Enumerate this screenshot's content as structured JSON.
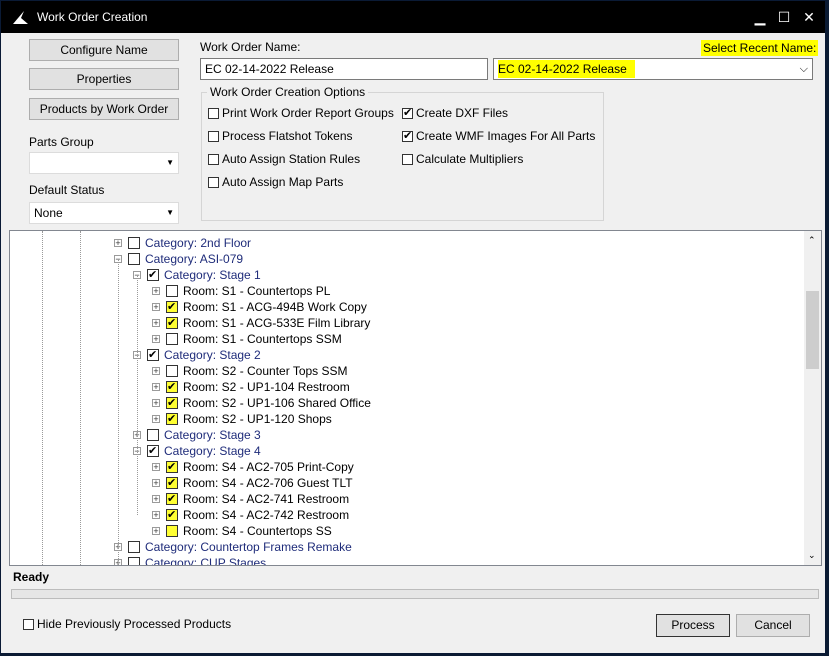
{
  "window": {
    "title": "Work Order Creation",
    "minimize": "▁",
    "maximize": "☐",
    "close": "✕"
  },
  "buttons": {
    "configure_name": "Configure Name",
    "properties": "Properties",
    "products_by_work_order": "Products by Work Order",
    "process": "Process",
    "cancel": "Cancel"
  },
  "left": {
    "parts_group_label": "Parts Group",
    "parts_group_value": "",
    "default_status_label": "Default Status",
    "default_status_value": "None"
  },
  "work_order": {
    "name_label": "Work Order Name:",
    "name_value": "EC 02-14-2022 Release",
    "recent_label": "Select Recent Name:",
    "recent_value": "EC 02-14-2022 Release"
  },
  "options": {
    "title": "Work Order Creation Options",
    "items": [
      {
        "label": "Print Work Order Report Groups",
        "checked": false
      },
      {
        "label": "Process Flatshot Tokens",
        "checked": false
      },
      {
        "label": "Auto Assign Station Rules",
        "checked": false
      },
      {
        "label": "Auto Assign Map Parts",
        "checked": false
      },
      {
        "label": "Create DXF Files",
        "checked": true
      },
      {
        "label": "Create WMF Images For All Parts",
        "checked": true
      },
      {
        "label": "Calculate Multipliers",
        "checked": false
      }
    ]
  },
  "tree": [
    {
      "level": 0,
      "text": "Category: 2nd Floor",
      "type": "cat",
      "checked": false,
      "hl": false,
      "exp": "+"
    },
    {
      "level": 0,
      "text": "Category: ASI-079",
      "type": "cat",
      "checked": false,
      "hl": false,
      "exp": "−"
    },
    {
      "level": 1,
      "text": "Category: Stage 1",
      "type": "cat",
      "checked": true,
      "hl": false,
      "exp": "−"
    },
    {
      "level": 2,
      "text": "Room: S1 - Countertops PL",
      "type": "room",
      "checked": false,
      "hl": false,
      "exp": "+"
    },
    {
      "level": 2,
      "text": "Room: S1 - ACG-494B Work Copy",
      "type": "room",
      "checked": true,
      "hl": true,
      "exp": "+"
    },
    {
      "level": 2,
      "text": "Room: S1 - ACG-533E Film Library",
      "type": "room",
      "checked": true,
      "hl": true,
      "exp": "+"
    },
    {
      "level": 2,
      "text": "Room: S1 - Countertops SSM",
      "type": "room",
      "checked": false,
      "hl": false,
      "exp": "+"
    },
    {
      "level": 1,
      "text": "Category: Stage 2",
      "type": "cat",
      "checked": true,
      "hl": false,
      "exp": "−"
    },
    {
      "level": 2,
      "text": "Room: S2 - Counter Tops SSM",
      "type": "room",
      "checked": false,
      "hl": false,
      "exp": "+"
    },
    {
      "level": 2,
      "text": "Room: S2 - UP1-104 Restroom",
      "type": "room",
      "checked": true,
      "hl": true,
      "exp": "+"
    },
    {
      "level": 2,
      "text": "Room: S2 - UP1-106 Shared Office",
      "type": "room",
      "checked": true,
      "hl": true,
      "exp": "+"
    },
    {
      "level": 2,
      "text": "Room: S2 - UP1-120 Shops",
      "type": "room",
      "checked": true,
      "hl": true,
      "exp": "+"
    },
    {
      "level": 1,
      "text": "Category: Stage 3",
      "type": "cat",
      "checked": false,
      "hl": false,
      "exp": "+"
    },
    {
      "level": 1,
      "text": "Category: Stage 4",
      "type": "cat",
      "checked": true,
      "hl": false,
      "exp": "−"
    },
    {
      "level": 2,
      "text": "Room: S4 - AC2-705 Print-Copy",
      "type": "room",
      "checked": true,
      "hl": true,
      "exp": "+"
    },
    {
      "level": 2,
      "text": "Room: S4 - AC2-706 Guest TLT",
      "type": "room",
      "checked": true,
      "hl": true,
      "exp": "+"
    },
    {
      "level": 2,
      "text": "Room: S4 - AC2-741 Restroom",
      "type": "room",
      "checked": true,
      "hl": true,
      "exp": "+"
    },
    {
      "level": 2,
      "text": "Room: S4 - AC2-742 Restroom",
      "type": "room",
      "checked": true,
      "hl": true,
      "exp": "+"
    },
    {
      "level": 2,
      "text": "Room: S4 - Countertops SS",
      "type": "room",
      "checked": false,
      "hl": true,
      "exp": "+"
    },
    {
      "level": 0,
      "text": "Category: Countertop Frames Remake",
      "type": "cat",
      "checked": false,
      "hl": false,
      "exp": "+"
    },
    {
      "level": 0,
      "text": "Category: CUP Stages",
      "type": "cat",
      "checked": false,
      "hl": false,
      "exp": "+"
    }
  ],
  "status": {
    "text": "Ready"
  },
  "footer": {
    "hide_processed_label": "Hide Previously Processed Products"
  },
  "colors": {
    "highlight": "#ffff00",
    "category_text": "#1f2c7a",
    "titlebar": "#000000"
  }
}
